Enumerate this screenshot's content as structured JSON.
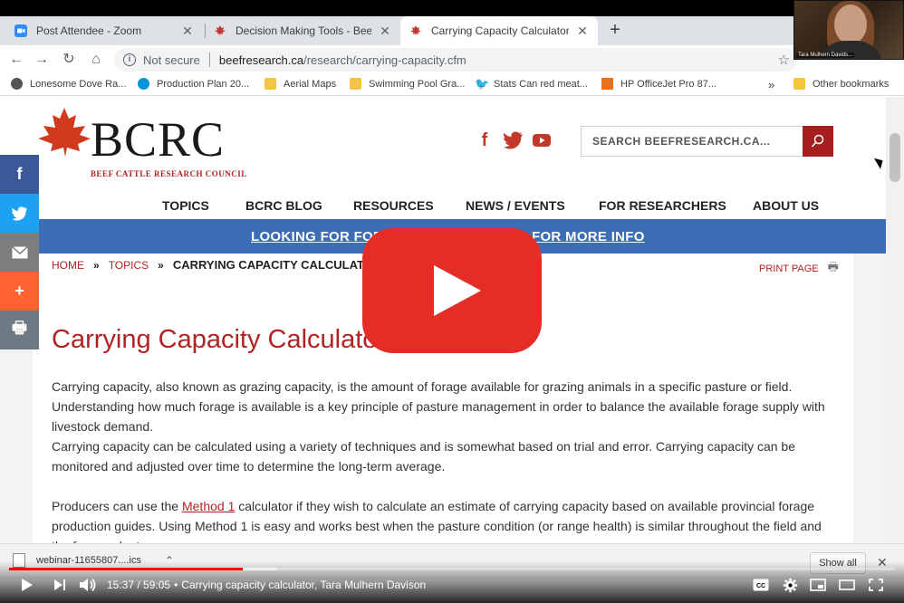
{
  "browser": {
    "tabs": [
      {
        "label": "Post Attendee - Zoom",
        "active": false
      },
      {
        "label": "Decision Making Tools - Beef Cat",
        "active": false
      },
      {
        "label": "Carrying Capacity Calculator - Be",
        "active": true
      }
    ],
    "address": {
      "security": "Not secure",
      "host": "beefresearch.ca",
      "path": "/research/carrying-capacity.cfm"
    },
    "bookmarks": [
      "Lonesome Dove Ra...",
      "Production Plan 20...",
      "Aerial Maps",
      "Swimming Pool Gra...",
      "Stats Can red meat...",
      "HP OfficeJet Pro 87...",
      "Other bookmarks"
    ],
    "overflow": "»"
  },
  "webcam": {
    "name": "Tara Mulhern Davids..."
  },
  "site": {
    "logo_text": "BCRC",
    "logo_sub": "BEEF CATTLE RESEARCH COUNCIL",
    "search_placeholder": "SEARCH BEEFRESEARCH.CA...",
    "nav": [
      "TOPICS",
      "BCRC BLOG",
      "RESOURCES",
      "NEWS / EVENTS",
      "FOR RESEARCHERS",
      "ABOUT US"
    ],
    "banner_left": "LOOKING FOR FORA",
    "banner_right": "FOR MORE INFO",
    "breadcrumb": {
      "home": "HOME",
      "sep": "»",
      "topics": "TOPICS",
      "current": "CARRYING CAPACITY CALCULATOR"
    },
    "print_page": "PRINT PAGE",
    "title": "Carrying Capacity Calculator",
    "para1": "Carrying capacity, also known as grazing capacity, is the amount of forage available for grazing animals in a specific pasture or field. Understanding how much forage is available is a key principle of pasture management in order to balance the available forage supply with livestock demand.",
    "para2": "Carrying capacity can be calculated using a variety of techniques and is somewhat based on trial and error. Carrying capacity can be monitored and adjusted over time to determine the long-term average.",
    "para3_before": "Producers can use the ",
    "para3_link": "Method 1",
    "para3_after": " calculator if they wish to calculate an estimate of carrying capacity based on available provincial forage production guides. Using Method 1 is easy and works best when the pasture condition (or range health) is similar throughout the field and the forage plant"
  },
  "download": {
    "file": "webinar-11655807....ics",
    "show_all": "Show all"
  },
  "player": {
    "current_time": "15:37",
    "duration": "59:05",
    "separator": "•",
    "title": "Carrying capacity calculator, Tara Mulhern Davison",
    "progress": 0.264,
    "buffered": 0.303
  },
  "colors": {
    "brand_red": "#b22222",
    "banner_blue": "#3d6db5",
    "youtube_red": "#e52d27"
  }
}
